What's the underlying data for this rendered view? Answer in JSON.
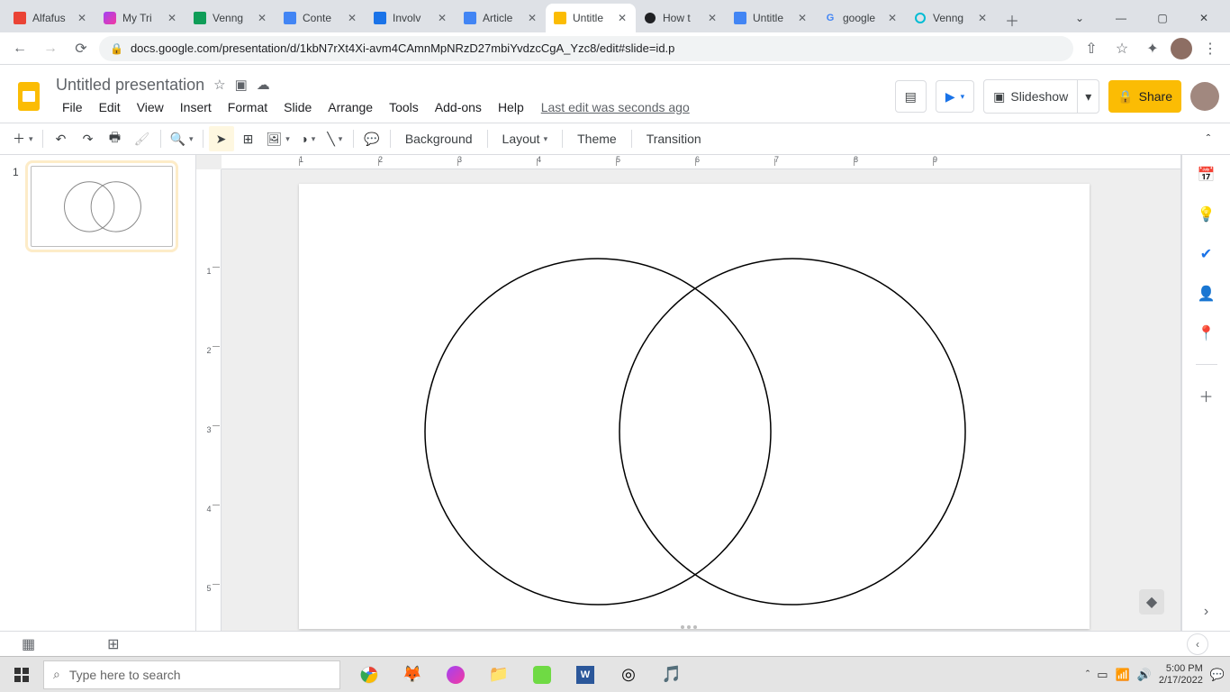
{
  "browser": {
    "tabs": [
      {
        "title": "Alfafus"
      },
      {
        "title": "My Tri"
      },
      {
        "title": "Venng"
      },
      {
        "title": "Conte"
      },
      {
        "title": "Involv"
      },
      {
        "title": "Article"
      },
      {
        "title": "Untitle"
      },
      {
        "title": "How t"
      },
      {
        "title": "Untitle"
      },
      {
        "title": "google"
      },
      {
        "title": "Venng"
      }
    ],
    "active_tab_index": 6,
    "url": "docs.google.com/presentation/d/1kbN7rXt4Xi-avm4CAmnMpNRzD27mbiYvdzcCgA_Yzc8/edit#slide=id.p"
  },
  "docs": {
    "title": "Untitled presentation",
    "menus": [
      "File",
      "Edit",
      "View",
      "Insert",
      "Format",
      "Slide",
      "Arrange",
      "Tools",
      "Add-ons",
      "Help"
    ],
    "last_edit": "Last edit was seconds ago",
    "slideshow_label": "Slideshow",
    "share_label": "Share",
    "toolbar": {
      "background": "Background",
      "layout": "Layout",
      "theme": "Theme",
      "transition": "Transition"
    },
    "slide_number": "1",
    "ruler_h": [
      "1",
      "2",
      "3",
      "4",
      "5",
      "6",
      "7",
      "8",
      "9"
    ],
    "ruler_v": [
      "1",
      "2",
      "3",
      "4",
      "5"
    ]
  },
  "taskbar": {
    "search_placeholder": "Type here to search",
    "time": "5:00 PM",
    "date": "2/17/2022"
  }
}
